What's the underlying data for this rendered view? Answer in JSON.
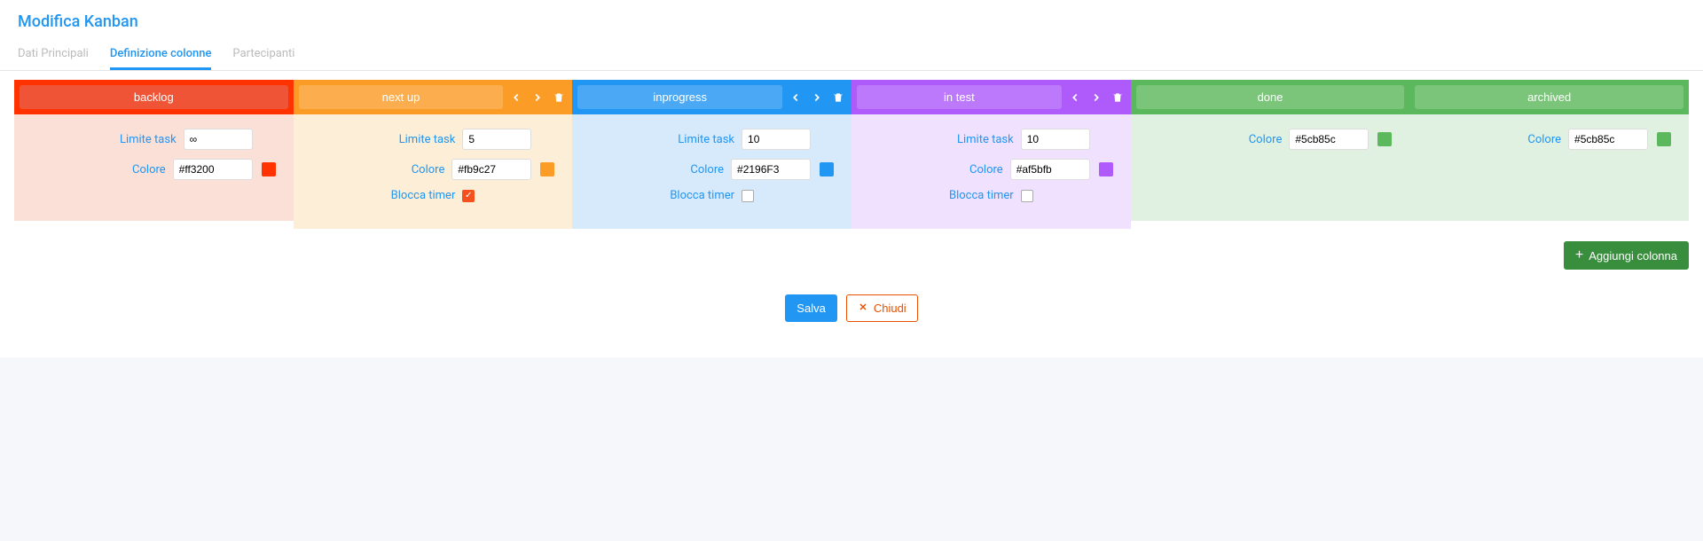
{
  "title": "Modifica Kanban",
  "tabs": [
    {
      "label": "Dati Principali",
      "active": false
    },
    {
      "label": "Definizione colonne",
      "active": true
    },
    {
      "label": "Partecipanti",
      "active": false
    }
  ],
  "labels": {
    "limit": "Limite task",
    "color": "Colore",
    "block_timer": "Blocca timer",
    "add_column": "Aggiungi colonna",
    "save": "Salva",
    "close": "Chiudi"
  },
  "columns": [
    {
      "name": "backlog",
      "header_bg": "#ff3200",
      "title_bg": "#ef5436",
      "body_bg": "#fbe0d8",
      "limit": "∞",
      "color_value": "#ff3200",
      "swatch": "#ff3200",
      "show_arrows": false,
      "show_delete": false,
      "show_block_timer": false,
      "block_timer_checked": false
    },
    {
      "name": "next up",
      "header_bg": "#fb9c27",
      "title_bg": "#fcae4f",
      "body_bg": "#fdeed7",
      "limit": "5",
      "color_value": "#fb9c27",
      "swatch": "#fb9c27",
      "show_arrows": true,
      "show_delete": true,
      "show_block_timer": true,
      "block_timer_checked": true
    },
    {
      "name": "inprogress",
      "header_bg": "#2196F3",
      "title_bg": "#4ba8f5",
      "body_bg": "#d6eafc",
      "limit": "10",
      "color_value": "#2196F3",
      "swatch": "#2196F3",
      "show_arrows": true,
      "show_delete": true,
      "show_block_timer": true,
      "block_timer_checked": false
    },
    {
      "name": "in test",
      "header_bg": "#af5bfb",
      "title_bg": "#bd79fc",
      "body_bg": "#f0e1fe",
      "limit": "10",
      "color_value": "#af5bfb",
      "swatch": "#af5bfb",
      "show_arrows": true,
      "show_delete": true,
      "show_block_timer": true,
      "block_timer_checked": false
    },
    {
      "name": "done",
      "header_bg": "#5cb85c",
      "title_bg": "#7bc57b",
      "body_bg": "#e1f1e1",
      "limit": null,
      "color_value": "#5cb85c",
      "swatch": "#5cb85c",
      "show_arrows": false,
      "show_delete": false,
      "show_block_timer": false,
      "block_timer_checked": false
    },
    {
      "name": "archived",
      "header_bg": "#5cb85c",
      "title_bg": "#7bc57b",
      "body_bg": "#e1f1e1",
      "limit": null,
      "color_value": "#5cb85c",
      "swatch": "#5cb85c",
      "show_arrows": false,
      "show_delete": false,
      "show_block_timer": false,
      "block_timer_checked": false
    }
  ]
}
